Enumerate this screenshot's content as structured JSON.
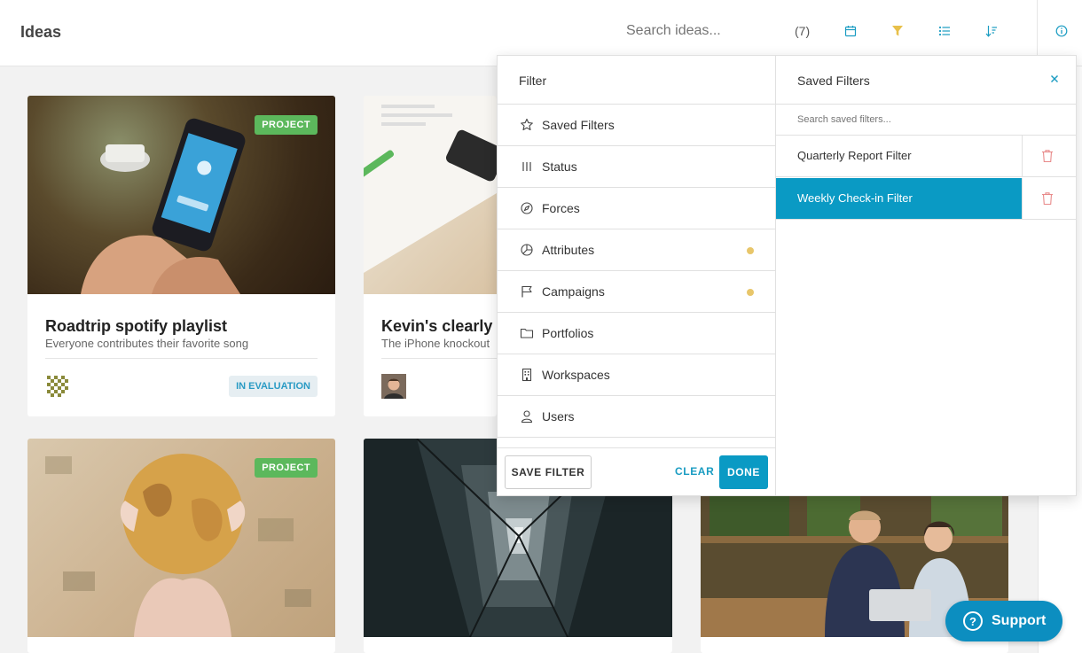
{
  "header": {
    "title": "Ideas",
    "search_placeholder": "Search ideas...",
    "count": "(7)",
    "icons": [
      "calendar-icon",
      "filter-icon",
      "list-icon",
      "sort-icon",
      "info-icon"
    ],
    "accent_color": "#0a9ac4",
    "filter_active_color": "#e8c04a"
  },
  "cards": [
    {
      "badge": "PROJECT",
      "title": "Roadtrip spotify playlist",
      "subtitle": "Everyone contributes their favorite song",
      "status": "IN EVALUATION",
      "image": "hand holding phone on wooden table"
    },
    {
      "title": "Kevin's clearly th",
      "subtitle": "The iPhone knockout",
      "image": "desk with phone and paper"
    },
    {
      "badge": "PROJECT",
      "image": "person holding globe"
    },
    {
      "image": "looking up inside building"
    },
    {
      "image": "two people with laptop at cafe"
    }
  ],
  "filter": {
    "title": "Filter",
    "items": [
      {
        "label": "Saved Filters",
        "icon": "star-icon"
      },
      {
        "label": "Status",
        "icon": "status-bars-icon"
      },
      {
        "label": "Forces",
        "icon": "compass-icon"
      },
      {
        "label": "Attributes",
        "icon": "pie-chart-icon",
        "dot": true
      },
      {
        "label": "Campaigns",
        "icon": "flag-icon",
        "dot": true
      },
      {
        "label": "Portfolios",
        "icon": "folder-icon"
      },
      {
        "label": "Workspaces",
        "icon": "building-icon"
      },
      {
        "label": "Users",
        "icon": "user-icon"
      }
    ],
    "save_label": "SAVE FILTER",
    "clear_label": "CLEAR",
    "done_label": "DONE"
  },
  "saved_filters": {
    "title": "Saved Filters",
    "search_placeholder": "Search saved filters...",
    "items": [
      {
        "name": "Quarterly Report Filter",
        "active": false
      },
      {
        "name": "Weekly Check-in Filter",
        "active": true
      }
    ]
  },
  "support": {
    "label": "Support"
  }
}
